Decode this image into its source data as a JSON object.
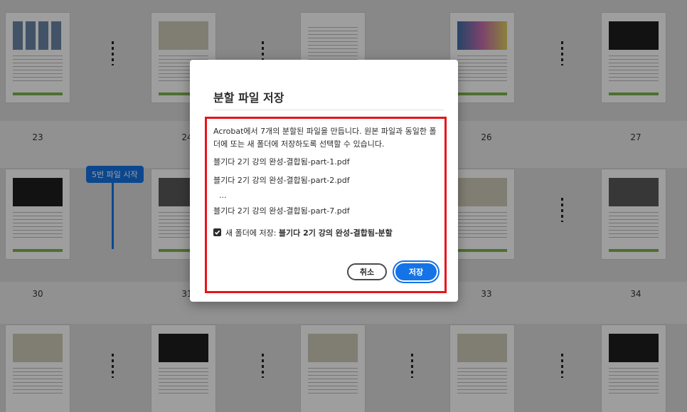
{
  "background": {
    "page_numbers": [
      "23",
      "24",
      "26",
      "27",
      "30",
      "31",
      "33",
      "34"
    ],
    "split_marker": "5번 파일 시작"
  },
  "dialog": {
    "title": "분할 파일 저장",
    "description": "Acrobat에서 7개의 분할된 파일을 만듭니다. 원본 파일과 동일한 폴더에 또는 새 폴더에 저장하도록 선택할 수 있습니다.",
    "files": [
      "블기다 2기 강의 완성-결합됨-part-1.pdf",
      "블기다 2기 강의 완성-결합됨-part-2.pdf",
      "블기다 2기 강의 완성-결합됨-part-7.pdf"
    ],
    "ellipsis": "...",
    "checkbox": {
      "checked": true,
      "label": "새 폴더에 저장: ",
      "folder_name": "블기다 2기 강의 완성-결합됨-분할"
    },
    "cancel_label": "취소",
    "save_label": "저장"
  },
  "colors": {
    "accent": "#1473e6",
    "highlight": "#e8131b"
  }
}
